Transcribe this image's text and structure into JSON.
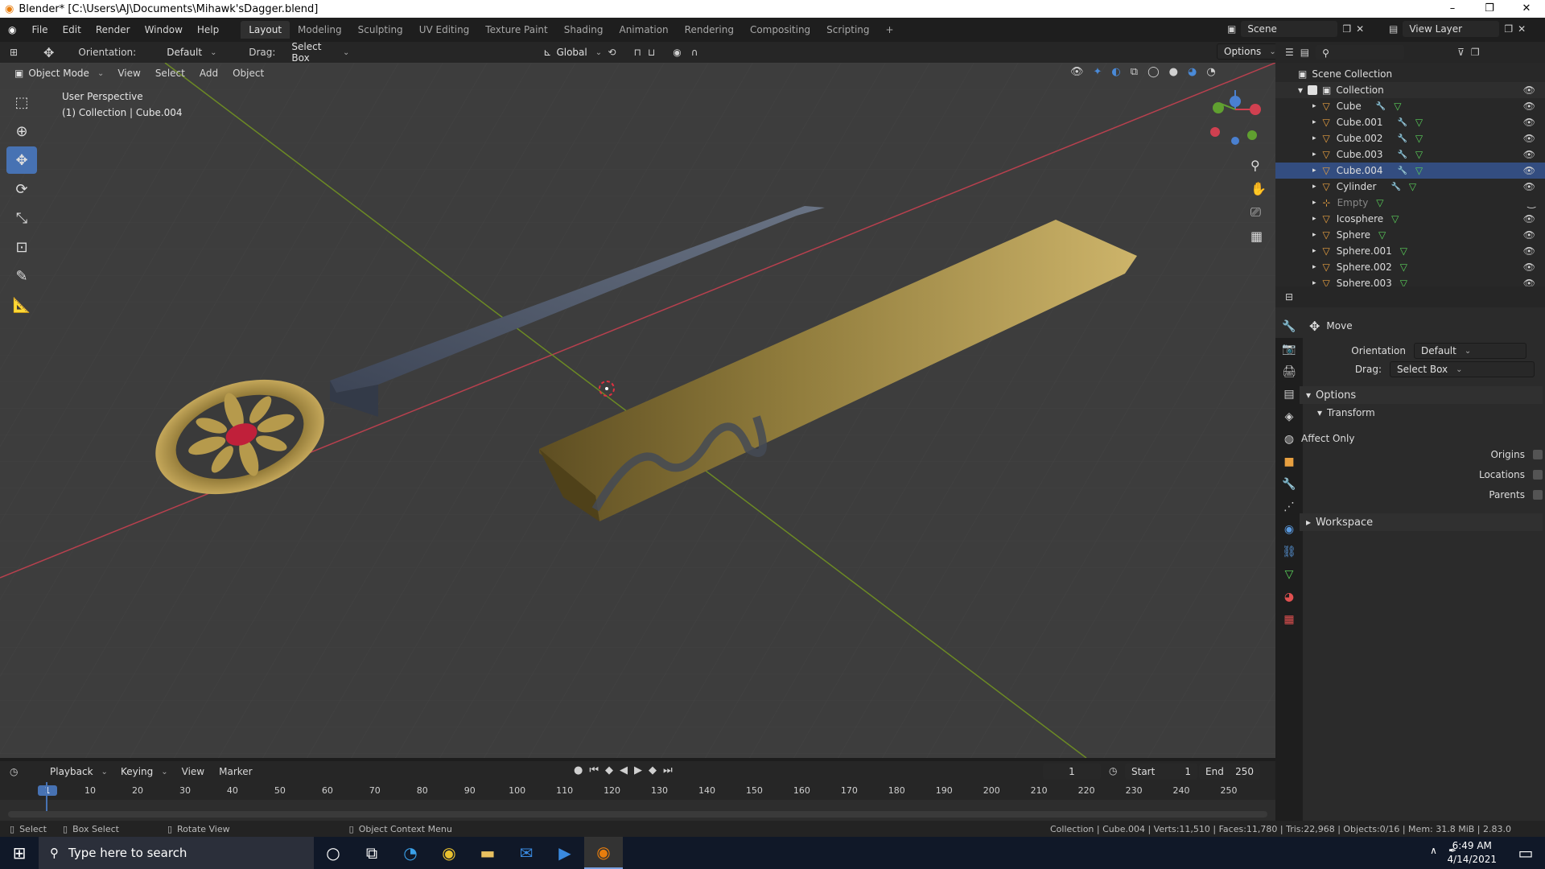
{
  "window": {
    "title": "Blender* [C:\\Users\\AJ\\Documents\\Mihawk'sDagger.blend]",
    "minimize": "–",
    "restore": "❐",
    "close": "✕"
  },
  "menu": {
    "items": [
      "File",
      "Edit",
      "Render",
      "Window",
      "Help"
    ],
    "workspaces": [
      "Layout",
      "Modeling",
      "Sculpting",
      "UV Editing",
      "Texture Paint",
      "Shading",
      "Animation",
      "Rendering",
      "Compositing",
      "Scripting"
    ],
    "active_workspace": "Layout",
    "add_tab": "+",
    "scene_label": "Scene",
    "view_layer_label": "View Layer"
  },
  "vp_header": {
    "orientation_label": "Orientation:",
    "orientation_value": "Default",
    "drag_label": "Drag:",
    "drag_value": "Select Box",
    "transform_orientation": "Global",
    "options_label": "Options"
  },
  "vp_header2": {
    "mode": "Object Mode",
    "menus": [
      "View",
      "Select",
      "Add",
      "Object"
    ]
  },
  "viewport": {
    "perspective": "User Perspective",
    "collection_info": "(1) Collection | Cube.004",
    "colors": {
      "background": "#3d3d3d",
      "x_axis": "#b8404e",
      "y_axis": "#6c8a24",
      "gold": "#b69a4c",
      "blade": "#4f5a6e",
      "ruby": "#c0203a"
    }
  },
  "outliner": {
    "search_placeholder": "",
    "scene_collection": "Scene Collection",
    "collection": "Collection",
    "items": [
      {
        "name": "Cube",
        "mod": true
      },
      {
        "name": "Cube.001",
        "mod": true
      },
      {
        "name": "Cube.002",
        "mod": true
      },
      {
        "name": "Cube.003",
        "mod": true
      },
      {
        "name": "Cube.004",
        "mod": true
      },
      {
        "name": "Cylinder",
        "mod": true
      },
      {
        "name": "Empty",
        "mod": false
      },
      {
        "name": "Icosphere",
        "mod": false
      },
      {
        "name": "Sphere",
        "mod": false
      },
      {
        "name": "Sphere.001",
        "mod": false
      },
      {
        "name": "Sphere.002",
        "mod": false
      },
      {
        "name": "Sphere.003",
        "mod": false
      }
    ]
  },
  "props": {
    "tool_name": "Move",
    "orientation_label": "Orientation",
    "orientation_value": "Default",
    "drag_label": "Drag:",
    "drag_value": "Select Box",
    "options_header": "Options",
    "transform_header": "Transform",
    "affect_only": "Affect Only",
    "origins": "Origins",
    "locations": "Locations",
    "parents": "Parents",
    "workspace_header": "Workspace"
  },
  "timeline": {
    "menus": [
      "Playback",
      "Keying",
      "View",
      "Marker"
    ],
    "current_frame": "1",
    "start_label": "Start",
    "start_value": "1",
    "end_label": "End",
    "end_value": "250",
    "ticks": [
      "1",
      "10",
      "20",
      "30",
      "40",
      "50",
      "60",
      "70",
      "80",
      "90",
      "100",
      "110",
      "120",
      "130",
      "140",
      "150",
      "160",
      "170",
      "180",
      "190",
      "200",
      "210",
      "220",
      "230",
      "240",
      "250"
    ]
  },
  "statusbar": {
    "select": "Select",
    "box_select": "Box Select",
    "rotate_view": "Rotate View",
    "context_menu": "Object Context Menu",
    "stats": "Collection | Cube.004 | Verts:11,510 | Faces:11,780 | Tris:22,968 | Objects:0/16 | Mem: 31.8 MiB | 2.83.0"
  },
  "taskbar": {
    "search_placeholder": "Type here to search",
    "time": "6:49 AM",
    "date": "4/14/2021"
  }
}
